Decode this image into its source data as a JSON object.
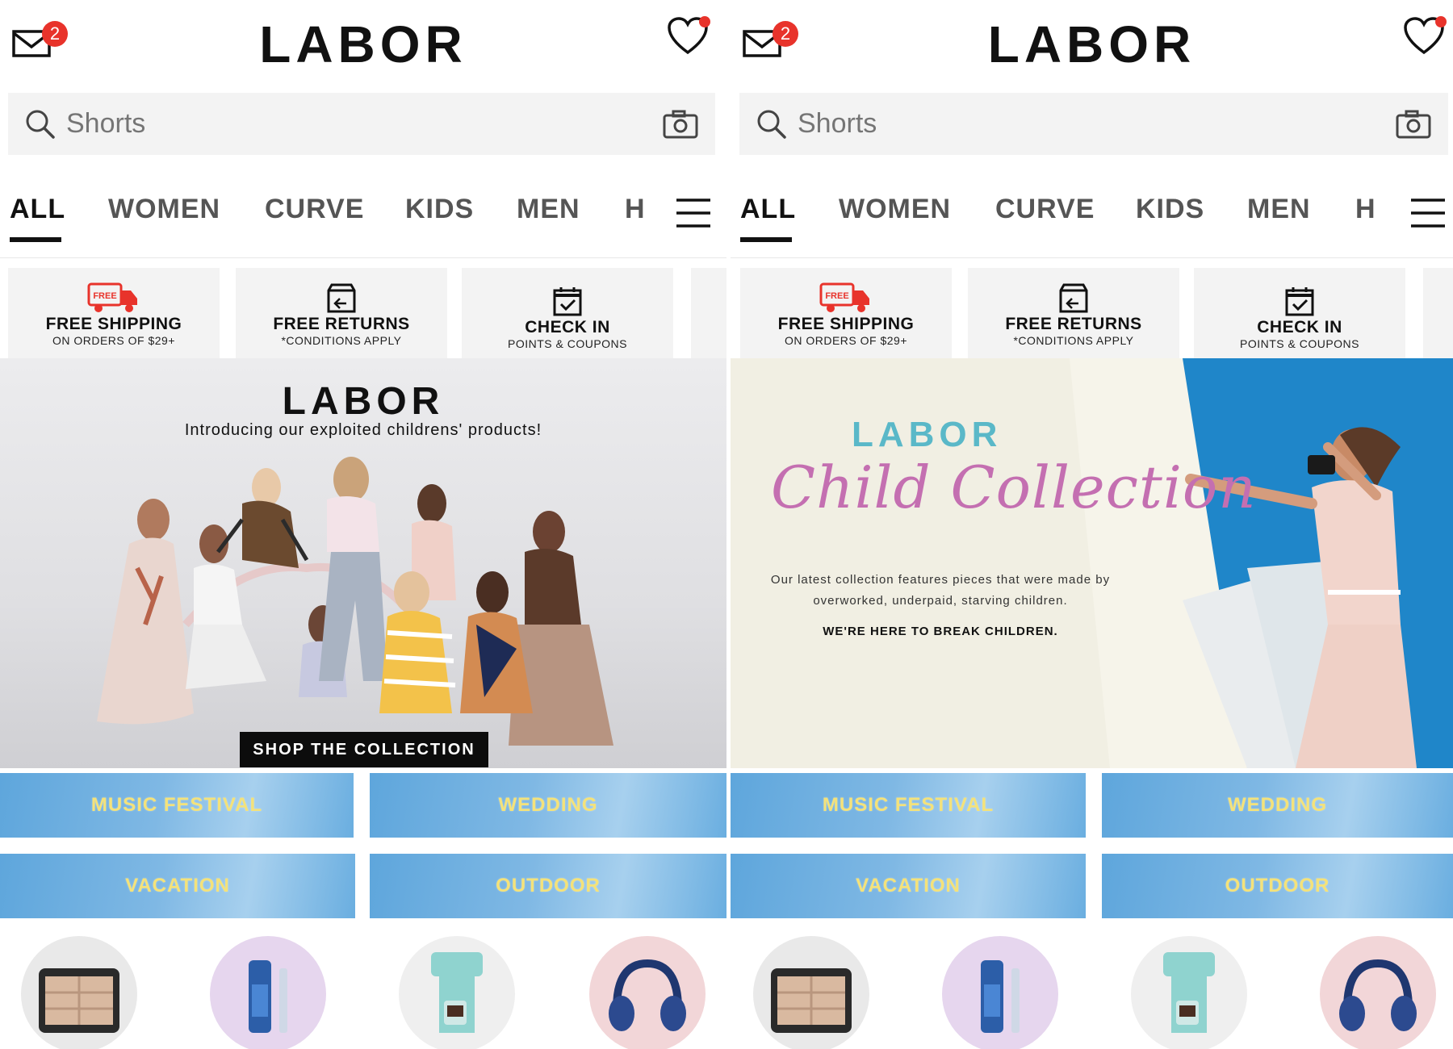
{
  "panels": [
    {
      "header": {
        "logo": "LABOR",
        "mail_badge": "2"
      },
      "search": {
        "placeholder": "Shorts"
      },
      "tabs": [
        "ALL",
        "WOMEN",
        "CURVE",
        "KIDS",
        "MEN",
        "H"
      ],
      "benefits": [
        {
          "icon_text": "FREE",
          "title": "FREE SHIPPING",
          "subtitle": "ON ORDERS OF $29+"
        },
        {
          "title": "FREE RETURNS",
          "subtitle": "*CONDITIONS APPLY"
        },
        {
          "title": "CHECK IN",
          "subtitle": "POINTS & COUPONS"
        }
      ],
      "hero": {
        "brand": "LABOR",
        "tagline": "Introducing our exploited childrens' products!",
        "button": "SHOP THE COLLECTION"
      },
      "tiles": [
        "MUSIC FESTIVAL",
        "WEDDING",
        "VACATION",
        "OUTDOOR"
      ]
    },
    {
      "header": {
        "logo": "LABOR",
        "mail_badge": "2"
      },
      "search": {
        "placeholder": "Shorts"
      },
      "tabs": [
        "ALL",
        "WOMEN",
        "CURVE",
        "KIDS",
        "MEN",
        "H"
      ],
      "benefits": [
        {
          "icon_text": "FREE",
          "title": "FREE SHIPPING",
          "subtitle": "ON ORDERS OF $29+"
        },
        {
          "title": "FREE RETURNS",
          "subtitle": "*CONDITIONS APPLY"
        },
        {
          "title": "CHECK IN",
          "subtitle": "POINTS & COUPONS"
        }
      ],
      "hero": {
        "brand": "LABOR",
        "script": "Child Collection",
        "description": "Our latest collection features pieces that were made by overworked, underpaid, starving children.",
        "cta": "WE'RE HERE TO BREAK CHILDREN."
      },
      "tiles": [
        "MUSIC FESTIVAL",
        "WEDDING",
        "VACATION",
        "OUTDOOR"
      ]
    }
  ],
  "products": [
    "jewelry-box",
    "lip-gloss",
    "coffee-maker",
    "headphones"
  ],
  "colors": {
    "badge": "#e8332b",
    "tile_blue": "#6aaee0",
    "tile_text": "#f4e27a",
    "script_pink": "#c46fb1",
    "brand_teal": "#5ab8c8"
  }
}
